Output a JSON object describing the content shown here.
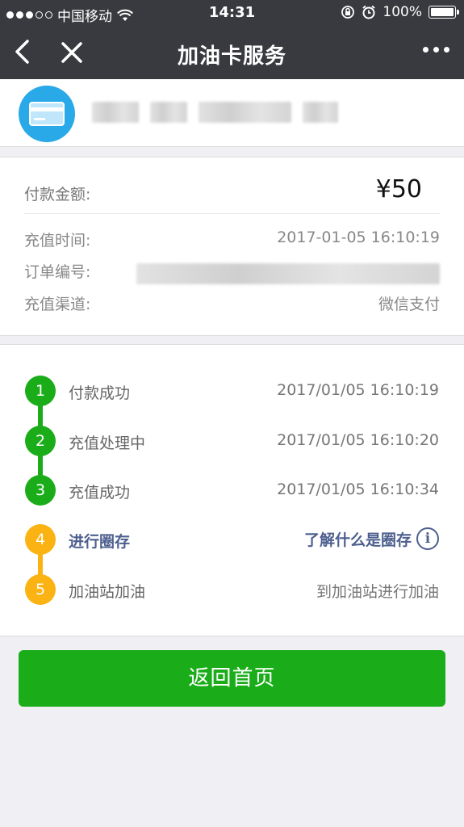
{
  "status_bar": {
    "carrier": "中国移动",
    "time": "14:31",
    "battery": "100%",
    "battery_level": 1.0
  },
  "nav": {
    "title": "加油卡服务"
  },
  "payment": {
    "amount_label": "付款金额:",
    "amount_value": "¥50",
    "recharge_time_label": "充值时间:",
    "recharge_time_value": "2017-01-05 16:10:19",
    "order_no_label": "订单编号:",
    "channel_label": "充值渠道:",
    "channel_value": "微信支付"
  },
  "steps": [
    {
      "num": "1",
      "label": "付款成功",
      "time": "2017/01/05 16:10:19",
      "color": "#1aad19"
    },
    {
      "num": "2",
      "label": "充值处理中",
      "time": "2017/01/05 16:10:20",
      "color": "#1aad19"
    },
    {
      "num": "3",
      "label": "充值成功",
      "time": "2017/01/05 16:10:34",
      "color": "#1aad19"
    },
    {
      "num": "4",
      "label": "进行圈存",
      "link": "了解什么是圈存",
      "color": "#fbb313"
    },
    {
      "num": "5",
      "label": "加油站加油",
      "time": "到加油站进行加油",
      "color": "#fbb313"
    }
  ],
  "button": {
    "label": "返回首页"
  },
  "colors": {
    "header_bg": "#393a3f",
    "accent_green": "#1aad19",
    "accent_orange": "#fbb313",
    "link_blue": "#4d5f8e",
    "page_bg": "#efeff4"
  },
  "icons": {
    "back": "chevron-left-icon",
    "close": "close-icon",
    "more": "more-icon",
    "wifi": "wifi-icon",
    "alarm": "alarm-icon",
    "lock": "rotation-lock-icon",
    "info": "info-icon",
    "merchant": "card-icon"
  }
}
